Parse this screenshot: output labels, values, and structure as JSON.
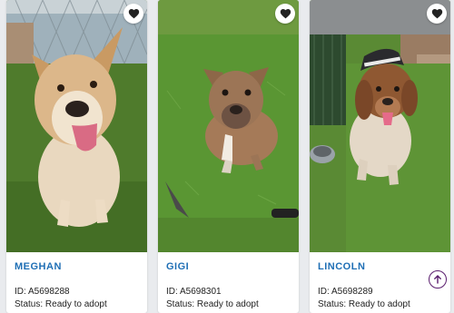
{
  "pets": [
    {
      "name": "MEGHAN",
      "id_text": "ID: A5698288",
      "status_text": "Status: Ready to adopt"
    },
    {
      "name": "GIGI",
      "id_text": "ID: A5698301",
      "status_text": "Status: Ready to adopt"
    },
    {
      "name": "LINCOLN",
      "id_text": "ID: A5698289",
      "status_text": "Status: Ready to adopt"
    }
  ],
  "icons": {
    "favorite": "heart-icon",
    "back_to_top": "arrow-up-icon"
  },
  "colors": {
    "name_link": "#1f6fb5",
    "scroll_top_border": "#5a1d6e"
  }
}
